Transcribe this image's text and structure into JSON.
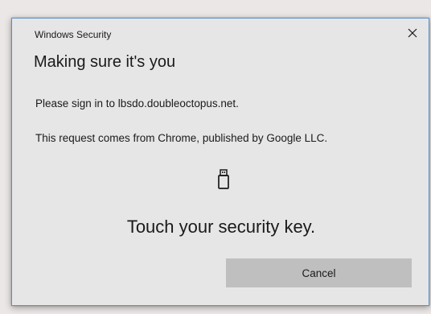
{
  "window": {
    "title": "Windows Security",
    "close_icon": "close-icon"
  },
  "content": {
    "heading": "Making sure it's you",
    "sign_in_text": "Please sign in to lbsdo.doubleoctopus.net.",
    "request_source_text": "This request comes from Chrome, published by Google LLC.",
    "key_icon": "usb-security-key-icon",
    "instruction": "Touch your security key."
  },
  "actions": {
    "cancel_label": "Cancel"
  },
  "colors": {
    "dialog_background": "#e6e6e6",
    "dialog_border": "#5a8fc7",
    "button_background": "#bfbfbf",
    "text": "#1a1a1a"
  }
}
